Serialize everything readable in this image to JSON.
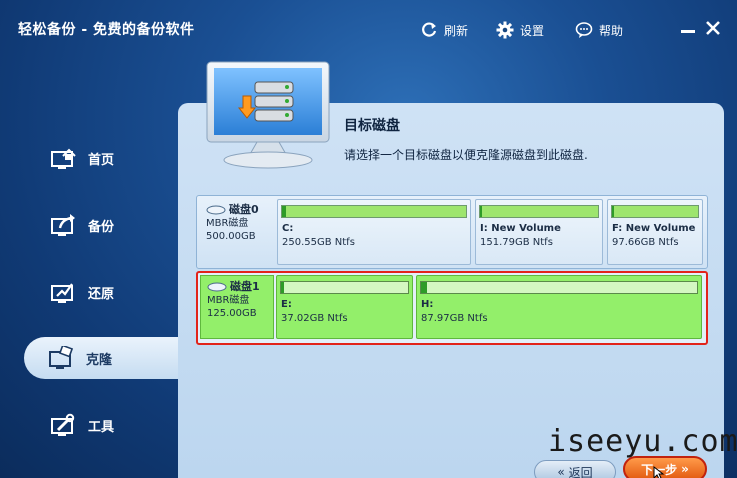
{
  "app": {
    "title": "轻松备份 - 免费的备份软件"
  },
  "toolbar": {
    "refresh_label": "刷新",
    "settings_label": "设置",
    "help_label": "帮助"
  },
  "sidebar": {
    "items": [
      {
        "label": "首页",
        "icon": "home-icon"
      },
      {
        "label": "备份",
        "icon": "backup-icon"
      },
      {
        "label": "还原",
        "icon": "restore-icon"
      },
      {
        "label": "克隆",
        "icon": "clone-icon",
        "active": true
      },
      {
        "label": "工具",
        "icon": "tools-icon"
      }
    ]
  },
  "main": {
    "title": "目标磁盘",
    "description": "请选择一个目标磁盘以便克隆源磁盘到此磁盘."
  },
  "disks": [
    {
      "name": "磁盘0",
      "type": "MBR磁盘",
      "size": "500.00GB",
      "selected": false,
      "partitions": [
        {
          "label": "C:",
          "size": "250.55GB Ntfs",
          "used_fraction": 0.02
        },
        {
          "label": "I: New Volume",
          "size": "151.79GB Ntfs",
          "used_fraction": 0.02
        },
        {
          "label": "F: New Volume",
          "size": "97.66GB Ntfs",
          "used_fraction": 0.02
        }
      ]
    },
    {
      "name": "磁盘1",
      "type": "MBR磁盘",
      "size": "125.00GB",
      "selected": true,
      "partitions": [
        {
          "label": "E:",
          "size": "37.02GB Ntfs",
          "used_fraction": 0.01
        },
        {
          "label": "H:",
          "size": "87.97GB Ntfs",
          "used_fraction": 0.01
        }
      ]
    }
  ],
  "footer": {
    "back_label": "返回",
    "next_label": "下一步"
  },
  "watermark": "iseeyu.com",
  "colors": {
    "accent": "#1a4f93",
    "selected_border": "#e2231a",
    "partition_green": "#93ef6a",
    "next_button": "#e2580e"
  }
}
